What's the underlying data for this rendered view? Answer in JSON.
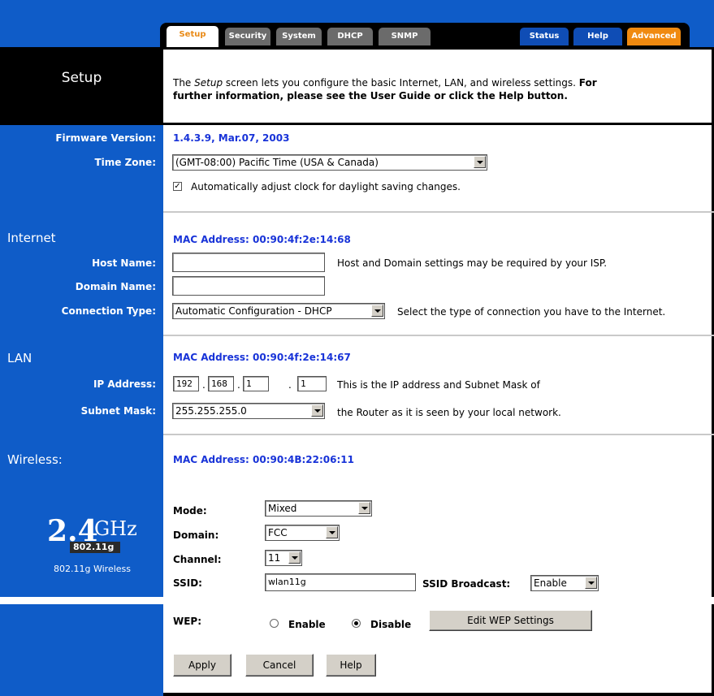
{
  "tabs": {
    "setup": "Setup",
    "security": "Security",
    "system": "System",
    "dhcp": "DHCP",
    "snmp": "SNMP",
    "status": "Status",
    "help": "Help",
    "advanced": "Advanced"
  },
  "page_title": "Setup",
  "intro": {
    "pre": "The ",
    "em": "Setup",
    "mid": " screen lets you configure the basic Internet, LAN, and wireless settings. ",
    "bold1": "For",
    "bold2": "further information, please see the User Guide or click the Help button."
  },
  "firmware": {
    "label": "Firmware Version:",
    "value": "1.4.3.9, Mar.07, 2003"
  },
  "timezone": {
    "label": "Time Zone:",
    "value": "(GMT-08:00) Pacific Time (USA & Canada)",
    "dst_label": "Automatically adjust clock for daylight saving changes.",
    "dst_checked": true
  },
  "internet": {
    "title": "Internet",
    "mac": "MAC Address:  00:90:4f:2e:14:68",
    "host_label": "Host Name:",
    "host_value": "",
    "domain_label": "Domain Name:",
    "domain_value": "",
    "host_note": "Host and Domain settings may be required by your ISP.",
    "conn_label": "Connection Type:",
    "conn_value": "Automatic Configuration - DHCP",
    "conn_note": "Select the type of connection you have to the Internet."
  },
  "lan": {
    "title": "LAN",
    "mac": "MAC Address:  00:90:4f:2e:14:67",
    "ip_label": "IP Address:",
    "ip": [
      "192",
      "168",
      "1",
      "1"
    ],
    "dot": ".",
    "ip_note": "This is the IP address and Subnet Mask of",
    "mask_label": "Subnet Mask:",
    "mask_value": "255.255.255.0",
    "mask_note": "the Router as it is seen by your local network."
  },
  "wireless": {
    "title": "Wireless:",
    "mac": "MAC Address:  00:90:4B:22:06:11",
    "logo_big": "2.4",
    "logo_ghz": "GHz",
    "logo_badge": "802.11g",
    "logo_caption": "802.11g Wireless",
    "mode_label": "Mode:",
    "mode_value": "Mixed",
    "domain_label": "Domain:",
    "domain_value": "FCC",
    "channel_label": "Channel:",
    "channel_value": "11",
    "ssid_label": "SSID:",
    "ssid_value": "wlan11g",
    "broadcast_label": "SSID Broadcast:",
    "broadcast_value": "Enable",
    "wep_label": "WEP:",
    "wep_enable": "Enable",
    "wep_disable": "Disable",
    "wep_selected": "Disable",
    "edit_wep": "Edit WEP Settings"
  },
  "buttons": {
    "apply": "Apply",
    "cancel": "Cancel",
    "help": "Help"
  },
  "colors": {
    "nav_blue": "#0f5cc8",
    "link_blue": "#1833d8",
    "tab_orange": "#f08a10",
    "tab_gray": "#6b6b6b"
  }
}
